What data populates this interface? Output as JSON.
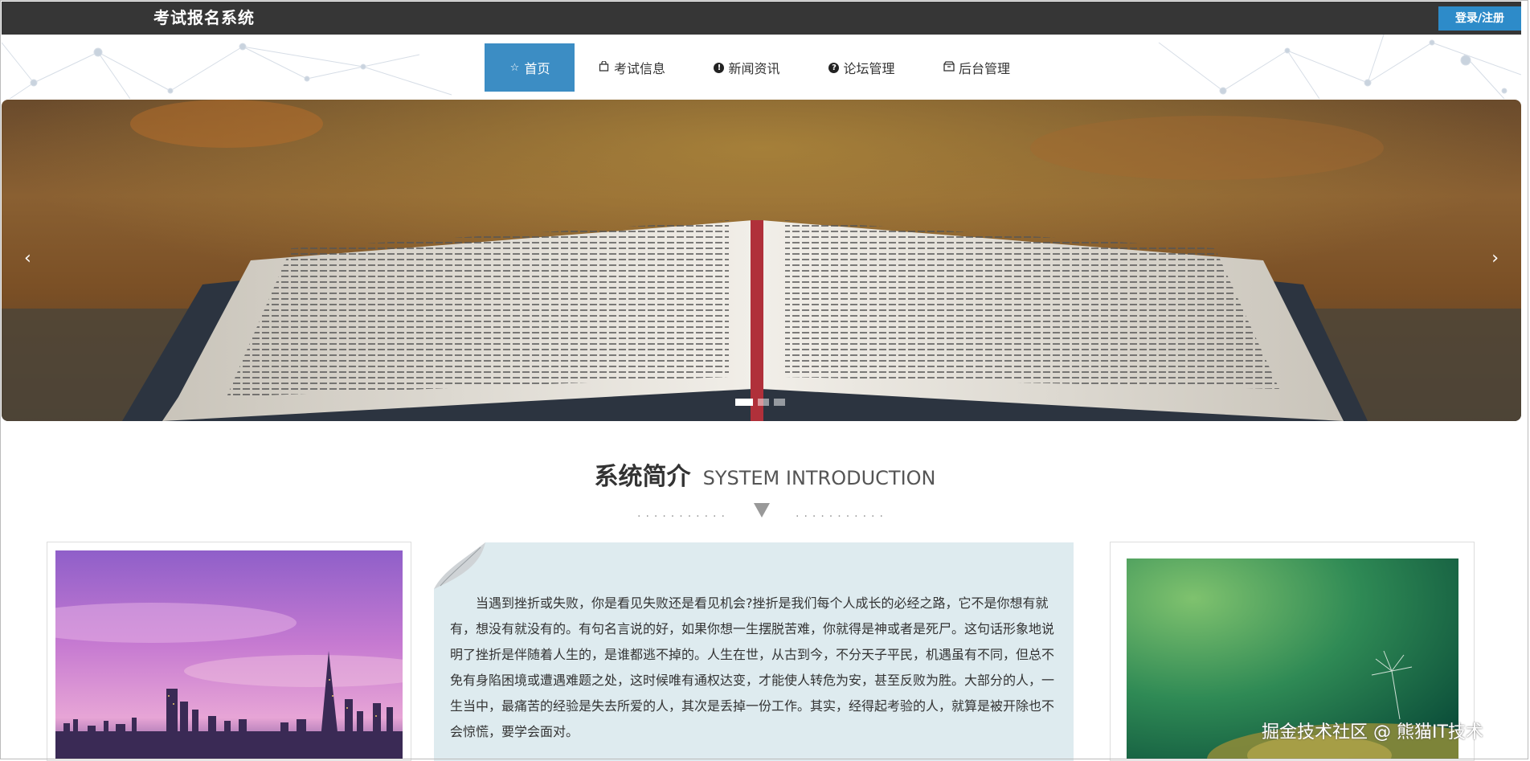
{
  "header": {
    "title": "考试报名系统",
    "login_label": "登录/注册"
  },
  "nav": {
    "items": [
      {
        "label": "首页",
        "icon": "star-icon",
        "active": true
      },
      {
        "label": "考试信息",
        "icon": "bag-icon"
      },
      {
        "label": "新闻资讯",
        "icon": "exclamation-icon"
      },
      {
        "label": "论坛管理",
        "icon": "question-icon"
      },
      {
        "label": "后台管理",
        "icon": "box-icon"
      }
    ]
  },
  "banner": {
    "prev_label": "‹",
    "next_label": "›",
    "slides": 3,
    "active_slide": 1
  },
  "intro": {
    "title_cn": "系统简介",
    "title_en": "SYSTEM INTRODUCTION",
    "dots_left": "...........",
    "dots_right": "...........",
    "text": "当遇到挫折或失败，你是看见失败还是看见机会?挫折是我们每个人成长的必经之路，它不是你想有就有，想没有就没有的。有句名言说的好，如果你想一生摆脱苦难，你就得是神或者是死尸。这句话形象地说明了挫折是伴随着人生的，是谁都逃不掉的。人生在世，从古到今，不分天子平民，机遇虽有不同，但总不免有身陷困境或遭遇难题之处，这时候唯有通权达变，才能使人转危为安，甚至反败为胜。大部分的人，一生当中，最痛苦的经验是失去所爱的人，其次是丢掉一份工作。其实，经得起考验的人，就算是被开除也不会惊慌，要学会面对。"
  },
  "watermark": "掘金技术社区 @ 熊猫IT技术",
  "colors": {
    "topbar": "#363636",
    "accent": "#3c8dc4",
    "login": "#2d8bc9",
    "intro_bg": "#deebef"
  }
}
